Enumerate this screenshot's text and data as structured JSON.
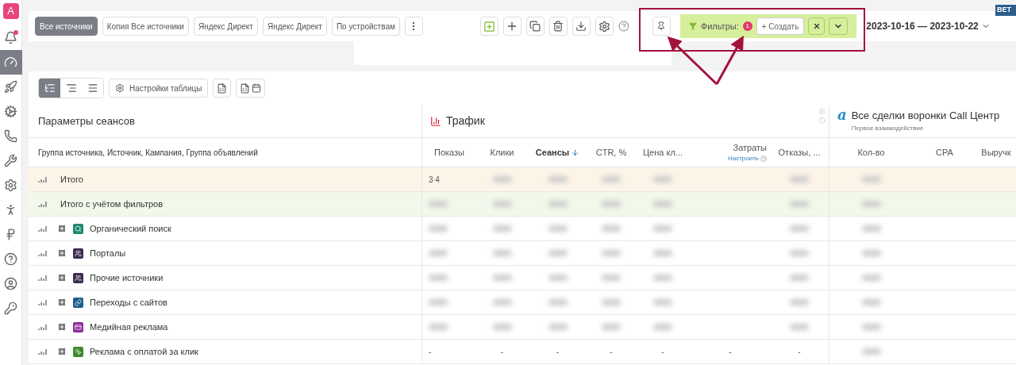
{
  "logo": "A",
  "sidebar": {
    "items": [
      {
        "kind": "bell",
        "selected": false,
        "alert": true
      },
      {
        "kind": "gauge",
        "selected": true,
        "alert": false
      },
      {
        "kind": "rocket",
        "selected": false,
        "alert": false
      },
      {
        "kind": "cogs",
        "selected": false,
        "alert": false
      },
      {
        "kind": "phone",
        "selected": false,
        "alert": false
      },
      {
        "kind": "tools",
        "selected": false,
        "alert": false
      },
      {
        "kind": "gear",
        "selected": false,
        "alert": false
      },
      {
        "kind": "person",
        "selected": false,
        "alert": false
      },
      {
        "kind": "ruble",
        "selected": false,
        "alert": false
      },
      {
        "kind": "help",
        "selected": false,
        "alert": false
      },
      {
        "kind": "user",
        "selected": false,
        "alert": false
      },
      {
        "kind": "key",
        "selected": false,
        "alert": false
      }
    ]
  },
  "report_tabs": [
    {
      "label": "Все источники",
      "selected": true
    },
    {
      "label": "Копия Все источники",
      "selected": false
    },
    {
      "label": "Яндекс Директ",
      "selected": false
    },
    {
      "label": "Яндекс Директ",
      "selected": false
    },
    {
      "label": "По устройствам",
      "selected": false
    }
  ],
  "filters": {
    "label": "Фильтры:",
    "count": "1",
    "create_button": "+ Создать"
  },
  "date_range": "2023-10-16 — 2023-10-22",
  "beta_badge": "BET",
  "view_modes": [
    {
      "kind": "tree",
      "selected": true
    },
    {
      "kind": "indent",
      "selected": false
    },
    {
      "kind": "flat",
      "selected": false
    }
  ],
  "table_settings_button": "Настройки таблицы",
  "table": {
    "groups": [
      {
        "kind": "params",
        "title": "Параметры сеансов"
      },
      {
        "kind": "traffic",
        "title": "Трафик"
      },
      {
        "kind": "funnel",
        "logo": "a",
        "title": "Все сделки воронки Call Центр",
        "subtitle": "Первое взаимодействие"
      }
    ],
    "dimension_header": "Группа источника, Источник, Кампания, Группа объявлений",
    "columns": [
      {
        "label": "Показы",
        "sorted": false
      },
      {
        "label": "Клики",
        "sorted": false
      },
      {
        "label": "Сеансы",
        "sorted": true
      },
      {
        "label": "CTR, %",
        "sorted": false
      },
      {
        "label": "Цена кл...",
        "sorted": false
      },
      {
        "label": "Затраты",
        "sorted": false,
        "link": "Настроить"
      },
      {
        "label": "Отказы, ...",
        "sorted": false
      },
      {
        "label": "Кол-во",
        "sorted": false
      },
      {
        "label": "CPA",
        "sorted": false
      },
      {
        "label": "Выручк",
        "sorted": false
      }
    ],
    "rows": [
      {
        "kind": "total",
        "label": "Итого",
        "blurred": true,
        "cells": [
          "3 4"
        ]
      },
      {
        "kind": "filtered",
        "label": "Итого с учётом фильтров",
        "blurred": true,
        "cells": []
      },
      {
        "kind": "source",
        "label": "Органический поиск",
        "color": "#1f8a70",
        "blurred": true,
        "cells": []
      },
      {
        "kind": "source",
        "label": "Порталы",
        "color": "#3b2a4f",
        "blurred": true,
        "cells": []
      },
      {
        "kind": "source",
        "label": "Прочие источники",
        "color": "#3b2a4f",
        "blurred": true,
        "cells": []
      },
      {
        "kind": "source",
        "label": "Переходы с сайтов",
        "color": "#1d5f8c",
        "blurred": true,
        "cells": []
      },
      {
        "kind": "source",
        "label": "Медийная реклама",
        "color": "#8e2c9c",
        "blurred": true,
        "cells": []
      },
      {
        "kind": "source",
        "label": "Реклама с оплатой за клик",
        "color": "#3c8a2c",
        "blurred": true,
        "cells": [
          "-",
          "-",
          "-",
          "-",
          "-",
          "-",
          "-"
        ]
      }
    ]
  }
}
